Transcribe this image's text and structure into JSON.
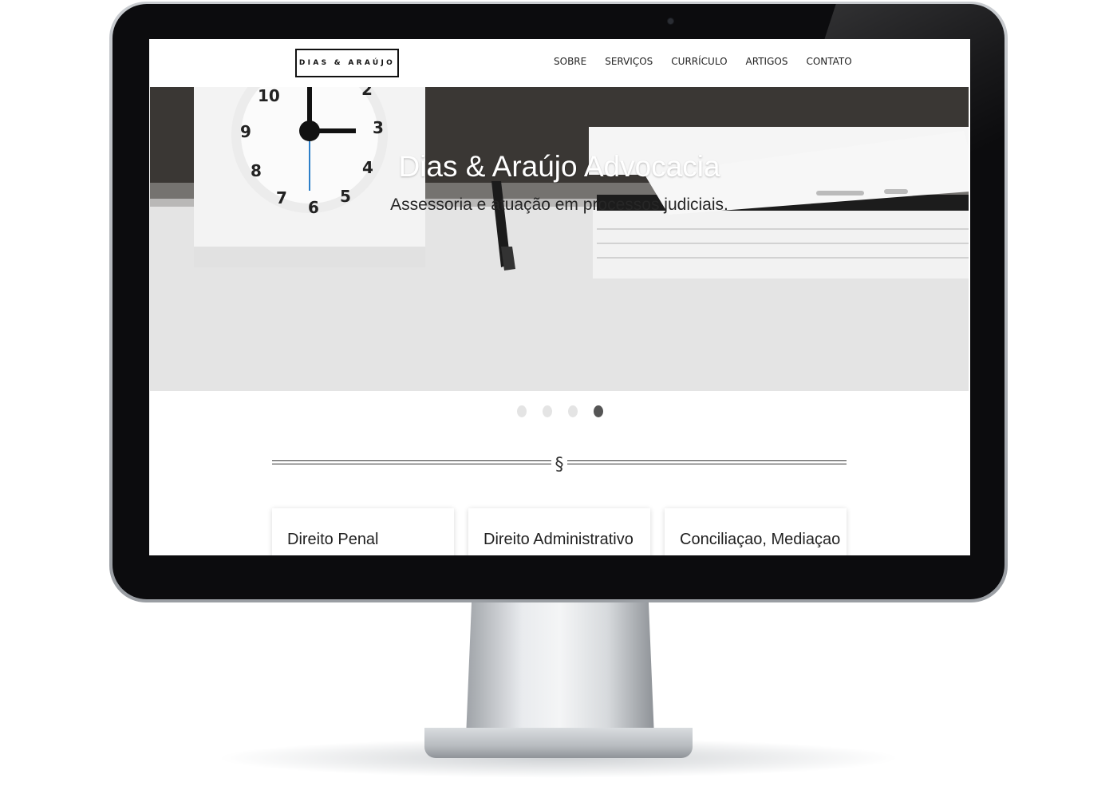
{
  "site": {
    "logo_text": "DIAS & ARAÚJO",
    "nav": [
      {
        "label": "SOBRE"
      },
      {
        "label": "SERVIÇOS"
      },
      {
        "label": "CURRÍCULO"
      },
      {
        "label": "ARTIGOS"
      },
      {
        "label": "CONTATO"
      }
    ]
  },
  "hero": {
    "title": "Dias & Araújo Advocacia",
    "subtitle": "Assessoria e atuação em processos judiciais.",
    "slide_count": 4,
    "active_slide": 4
  },
  "divider": {
    "symbol": "§"
  },
  "services": [
    {
      "title": "Direito Penal"
    },
    {
      "title": "Direito Administrativo"
    },
    {
      "title": "Conciliaçao, Mediaçao"
    }
  ],
  "colors": {
    "text_dark": "#222222",
    "dot_inactive": "#e4e4e4",
    "dot_active": "#555555",
    "bezel": "#0c0c0e"
  },
  "icons": {
    "section_divider": "section-sign",
    "webcam": "webcam-dot"
  }
}
